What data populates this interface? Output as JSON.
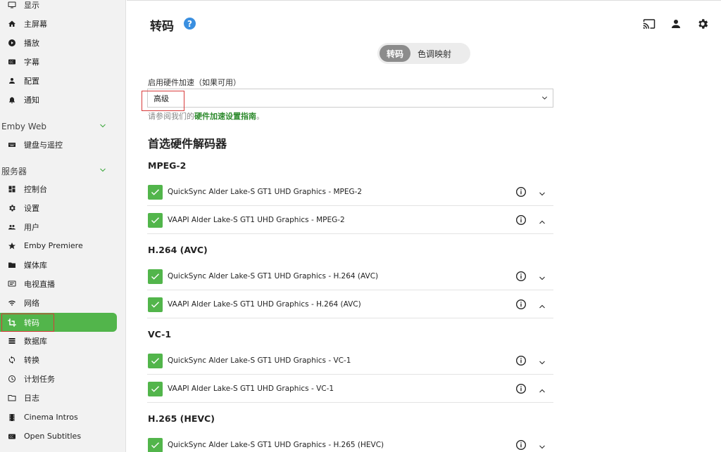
{
  "sidebar": {
    "items_top": [
      {
        "label": "显示",
        "icon": "monitor-icon"
      },
      {
        "label": "主屏幕",
        "icon": "home-icon"
      },
      {
        "label": "播放",
        "icon": "play-icon"
      },
      {
        "label": "字幕",
        "icon": "subtitles-icon"
      },
      {
        "label": "配置",
        "icon": "person-icon"
      },
      {
        "label": "通知",
        "icon": "bell-icon"
      }
    ],
    "section_emby_web": "Emby Web",
    "items_web": [
      {
        "label": "键盘与遥控",
        "icon": "keyboard-icon"
      }
    ],
    "section_server": "服务器",
    "items_server": [
      {
        "label": "控制台",
        "icon": "dashboard-icon"
      },
      {
        "label": "设置",
        "icon": "gear-icon"
      },
      {
        "label": "用户",
        "icon": "users-icon"
      },
      {
        "label": "Emby Premiere",
        "icon": "star-icon"
      },
      {
        "label": "媒体库",
        "icon": "folder-icon"
      },
      {
        "label": "电视直播",
        "icon": "tv-icon"
      },
      {
        "label": "网络",
        "icon": "wifi-icon"
      },
      {
        "label": "转码",
        "icon": "crop-icon"
      },
      {
        "label": "数据库",
        "icon": "database-icon"
      },
      {
        "label": "转换",
        "icon": "sync-icon"
      },
      {
        "label": "计划任务",
        "icon": "clock-icon"
      },
      {
        "label": "日志",
        "icon": "folder-outline-icon"
      },
      {
        "label": "Cinema Intros",
        "icon": "film-icon"
      },
      {
        "label": "Open Subtitles",
        "icon": "subtitles-icon"
      }
    ],
    "active_item": "转码"
  },
  "header": {
    "title": "转码",
    "help": "?"
  },
  "tabs": [
    {
      "label": "转码",
      "active": true
    },
    {
      "label": "色调映射",
      "active": false
    }
  ],
  "hw_accel": {
    "label": "启用硬件加速（如果可用）",
    "value": "高级",
    "hint_prefix": "请参阅我们的",
    "hint_link": "硬件加速设置指南",
    "hint_suffix": "。"
  },
  "decoders": {
    "title": "首选硬件解码器",
    "groups": [
      {
        "name": "MPEG-2",
        "rows": [
          "QuickSync Alder Lake-S GT1 UHD Graphics - MPEG-2",
          "VAAPI Alder Lake-S GT1 UHD Graphics - MPEG-2"
        ]
      },
      {
        "name": "H.264 (AVC)",
        "rows": [
          "QuickSync Alder Lake-S GT1 UHD Graphics - H.264 (AVC)",
          "VAAPI Alder Lake-S GT1 UHD Graphics - H.264 (AVC)"
        ]
      },
      {
        "name": "VC-1",
        "rows": [
          "QuickSync Alder Lake-S GT1 UHD Graphics - VC-1",
          "VAAPI Alder Lake-S GT1 UHD Graphics - VC-1"
        ]
      },
      {
        "name": "H.265 (HEVC)",
        "rows": [
          "QuickSync Alder Lake-S GT1 UHD Graphics - H.265 (HEVC)"
        ]
      }
    ]
  },
  "colors": {
    "accent": "#52b54b",
    "help": "#3a8fe0",
    "highlight": "#d83a3a"
  }
}
